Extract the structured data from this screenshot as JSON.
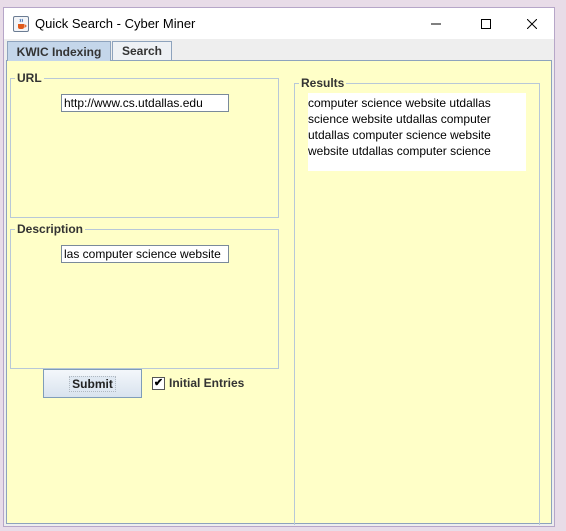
{
  "window": {
    "title": "Quick Search - Cyber Miner",
    "icon": "java-cup-icon"
  },
  "tabs": [
    {
      "label": "KWIC Indexing",
      "selected": true
    },
    {
      "label": "Search",
      "selected": false
    }
  ],
  "url_group": {
    "title": "URL",
    "value": "http://www.cs.utdallas.edu"
  },
  "description_group": {
    "title": "Description",
    "value": "las computer science website"
  },
  "results_group": {
    "title": "Results",
    "lines": [
      "computer science website utdallas",
      "science website utdallas computer",
      "utdallas computer science website",
      "website utdallas computer science"
    ]
  },
  "actions": {
    "submit_label": "Submit",
    "initial_entries_label": "Initial Entries",
    "initial_entries_checked": true,
    "check_mark": "✔"
  },
  "colors": {
    "panel_background": "#ffffc8",
    "selected_tab": "#c4d6ea",
    "border": "#8ea3bd"
  }
}
